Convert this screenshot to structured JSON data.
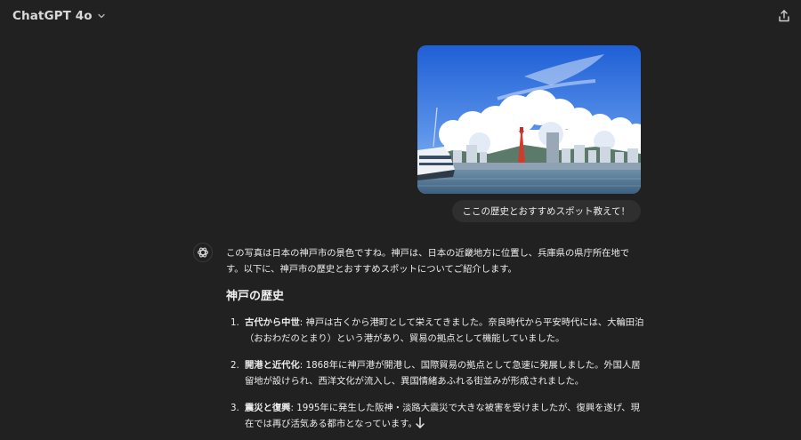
{
  "header": {
    "model_name": "ChatGPT 4o",
    "chevron_icon": "chevron-down-icon",
    "share_icon": "share-upload-icon"
  },
  "user_message": {
    "image_subject": "kobe-harbor-photo",
    "text": "ここの歴史とおすすめスポット教えて！"
  },
  "assistant": {
    "avatar_icon": "openai-logo-icon",
    "intro": "この写真は日本の神戸市の景色ですね。神戸は、日本の近畿地方に位置し、兵庫県の県庁所在地です。以下に、神戸市の歴史とおすすめスポットについてご紹介します。",
    "section_title": "神戸の歴史",
    "history": [
      {
        "num": "1.",
        "term": "古代から中世",
        "text": ": 神戸は古くから港町として栄えてきました。奈良時代から平安時代には、大輪田泊（おおわだのとまり）という港があり、貿易の拠点として機能していました。"
      },
      {
        "num": "2.",
        "term": "開港と近代化",
        "text": ": 1868年に神戸港が開港し、国際貿易の拠点として急速に発展しました。外国人居留地が設けられ、西洋文化が流入し、異国情緒あふれる街並みが形成されました。"
      },
      {
        "num": "3.",
        "term": "震災と復興",
        "text": ": 1995年に発生した阪神・淡路大震災で大きな被害を受けましたが、復興を遂げ、現在では再び活気ある都市となっています。"
      }
    ]
  },
  "scroll_button_icon": "arrow-down-icon",
  "colors": {
    "background": "#212121",
    "bubble": "#2f2f2f",
    "text": "#ececec"
  }
}
